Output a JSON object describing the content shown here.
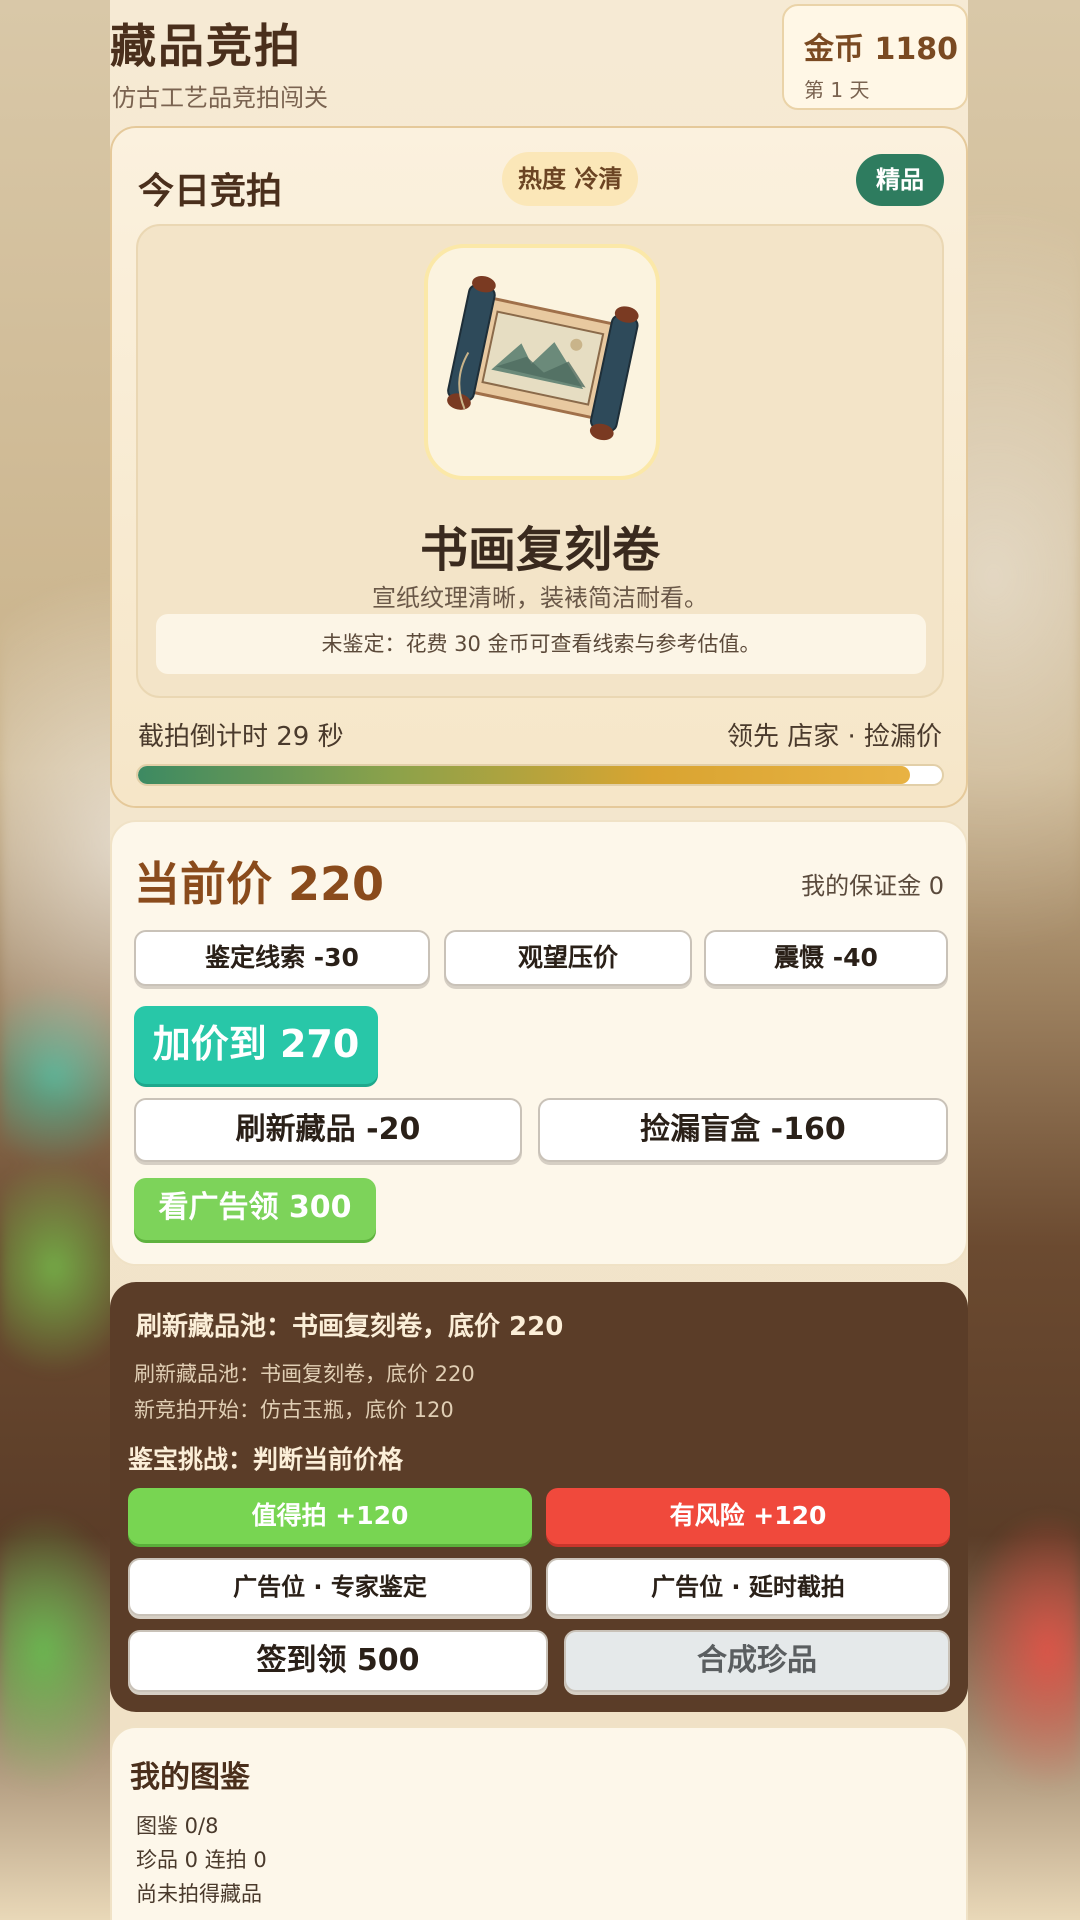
{
  "header": {
    "title": "藏品竞拍",
    "subtitle": "仿古工艺品竞拍闯关",
    "coins": "金币 1180",
    "day": "第 1 天"
  },
  "auction": {
    "heading": "今日竞拍",
    "heat": "热度 冷清",
    "grade_badge": "精品",
    "item_image_icon": "scroll-painting-icon",
    "item_name": "书画复刻卷",
    "item_desc": "宣纸纹理清晰，装裱简洁耐看。",
    "appraisal_hint": "未鉴定：花费 30 金币可查看线索与参考估值。",
    "countdown": "截拍倒计时 29 秒",
    "leader": "领先 店家 · 捡漏价",
    "countdown_progress": 0.96
  },
  "bidding": {
    "current_price": "当前价 220",
    "deposit": "我的保证金 0",
    "appraise_btn": "鉴定线索 -30",
    "watch_btn": "观望压价",
    "deter_btn": "震慑 -40",
    "raise_btn": "加价到 270",
    "refresh_btn": "刷新藏品 -20",
    "blindbox_btn": "捡漏盲盒 -160",
    "ad_reward_btn": "看广告领 300"
  },
  "log": {
    "title": "刷新藏品池：书画复刻卷，底价 220",
    "lines": [
      "刷新藏品池：书画复刻卷，底价 220",
      "新竞拍开始：仿古玉瓶，底价 120"
    ],
    "challenge_title": "鉴宝挑战：判断当前价格",
    "worth_btn": "值得拍 +120",
    "risk_btn": "有风险 +120",
    "ad_expert_btn": "广告位 · 专家鉴定",
    "ad_delay_btn": "广告位 · 延时截拍",
    "signin_btn": "签到领 500",
    "synth_btn": "合成珍品"
  },
  "collection": {
    "title": "我的图鉴",
    "progress": "图鉴 0/8",
    "stats": "珍品 0 连拍 0",
    "empty": "尚未拍得藏品"
  },
  "colors": {
    "accent_teal": "#28c7a8",
    "green": "#78d552",
    "red": "#f0493c",
    "dark_panel": "#5b3d28",
    "badge_green": "#2e7c5f"
  }
}
